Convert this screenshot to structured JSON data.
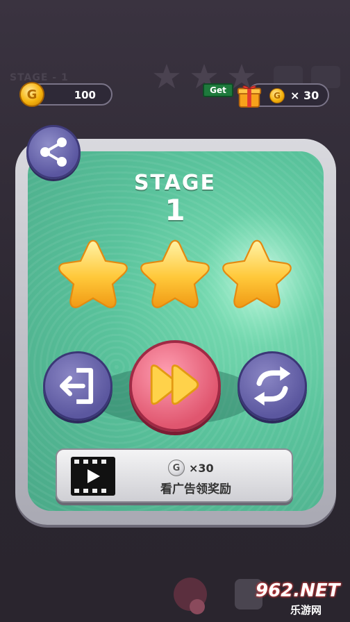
{
  "background": {
    "stage_label": "STAGE - 1"
  },
  "hud": {
    "coins": "100",
    "get_label": "Get",
    "reward_amount": "× 30",
    "coin_letter": "G"
  },
  "result": {
    "title": "STAGE",
    "stage_number": "1",
    "stars_earned": 3,
    "stars_total": 3
  },
  "actions": {
    "ad_reward_amount": "×30",
    "ad_reward_text": "看广告领奖励"
  },
  "watermark": {
    "main": "962.NET",
    "sub": "乐游网"
  },
  "colors": {
    "panel_green": "#5ac39c",
    "button_purple": "#5b579f",
    "play_pink": "#e0566f",
    "star_yellow": "#ffc83a"
  }
}
